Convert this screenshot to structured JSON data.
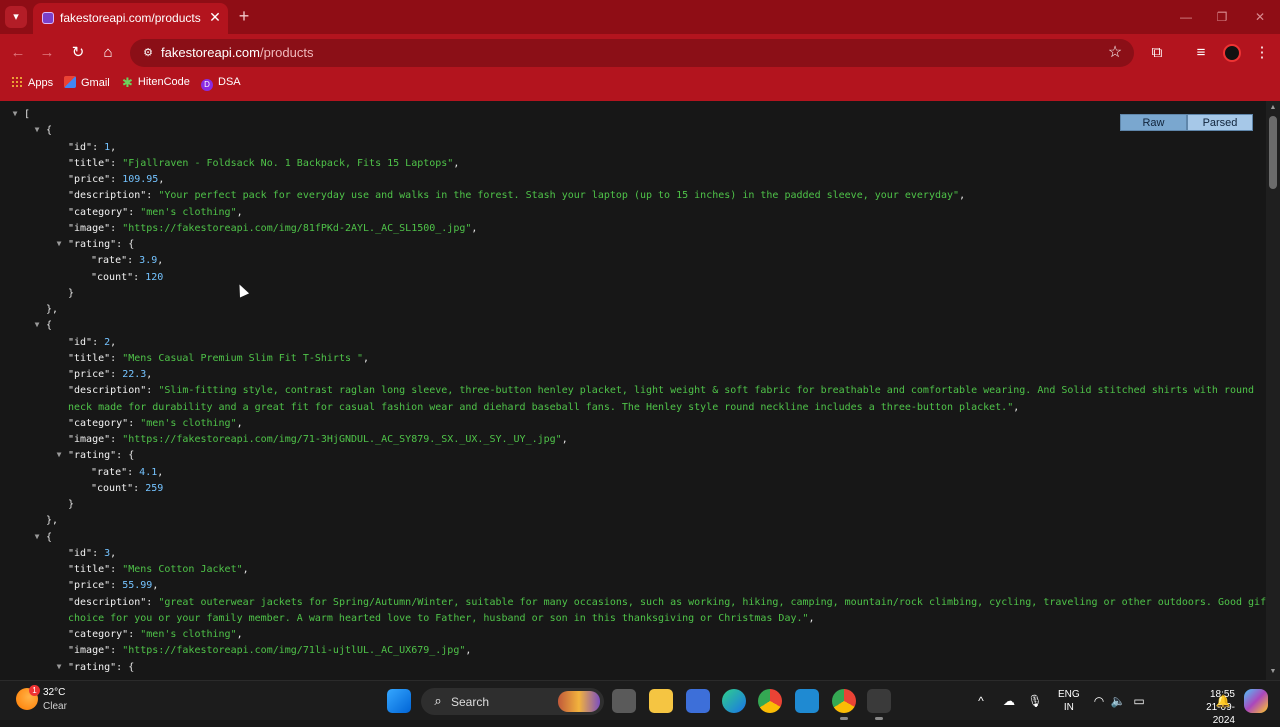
{
  "browser": {
    "tab_title": "fakestoreapi.com/products",
    "url_host": "fakestoreapi.com",
    "url_path": "/products",
    "bookmarks": [
      "Apps",
      "Gmail",
      "HitenCode",
      "DSA"
    ]
  },
  "viewer": {
    "raw_label": "Raw",
    "parsed_label": "Parsed"
  },
  "json_lines": [
    {
      "t": "[",
      "d": 0,
      "tog": true
    },
    {
      "t": "{",
      "d": 1,
      "tog": true
    },
    {
      "k": "id",
      "v": "1",
      "vt": "n",
      "d": 2
    },
    {
      "k": "title",
      "v": "\"Fjallraven - Foldsack No. 1 Backpack, Fits 15 Laptops\"",
      "vt": "s",
      "d": 2
    },
    {
      "k": "price",
      "v": "109.95",
      "vt": "n",
      "d": 2
    },
    {
      "k": "description",
      "v": "\"Your perfect pack for everyday use and walks in the forest. Stash your laptop (up to 15 inches) in the padded sleeve, your everyday\"",
      "vt": "s",
      "d": 2
    },
    {
      "k": "category",
      "v": "\"men's clothing\"",
      "vt": "s",
      "d": 2
    },
    {
      "k": "image",
      "v": "\"https://fakestoreapi.com/img/81fPKd-2AYL._AC_SL1500_.jpg\"",
      "vt": "s",
      "d": 2
    },
    {
      "k": "rating",
      "v": "{",
      "vt": "p",
      "d": 2,
      "tog": true,
      "nocomma": true
    },
    {
      "k": "rate",
      "v": "3.9",
      "vt": "n",
      "d": 3
    },
    {
      "k": "count",
      "v": "120",
      "vt": "n",
      "d": 3,
      "nocomma": true
    },
    {
      "t": "}",
      "d": 2
    },
    {
      "t": "},",
      "d": 1
    },
    {
      "t": "{",
      "d": 1,
      "tog": true
    },
    {
      "k": "id",
      "v": "2",
      "vt": "n",
      "d": 2
    },
    {
      "k": "title",
      "v": "\"Mens Casual Premium Slim Fit T-Shirts \"",
      "vt": "s",
      "d": 2
    },
    {
      "k": "price",
      "v": "22.3",
      "vt": "n",
      "d": 2
    },
    {
      "k": "description",
      "v": "\"Slim-fitting style, contrast raglan long sleeve, three-button henley placket, light weight & soft fabric for breathable and comfortable wearing. And Solid stitched shirts with round",
      "vt": "s",
      "d": 2,
      "nocomma": true
    },
    {
      "cont": "neck made for durability and a great fit for casual fashion wear and diehard baseball fans. The Henley style round neckline includes a three-button placket.\"",
      "vt": "s",
      "d": 2
    },
    {
      "k": "category",
      "v": "\"men's clothing\"",
      "vt": "s",
      "d": 2
    },
    {
      "k": "image",
      "v": "\"https://fakestoreapi.com/img/71-3HjGNDUL._AC_SY879._SX._UX._SY._UY_.jpg\"",
      "vt": "s",
      "d": 2
    },
    {
      "k": "rating",
      "v": "{",
      "vt": "p",
      "d": 2,
      "tog": true,
      "nocomma": true
    },
    {
      "k": "rate",
      "v": "4.1",
      "vt": "n",
      "d": 3
    },
    {
      "k": "count",
      "v": "259",
      "vt": "n",
      "d": 3,
      "nocomma": true
    },
    {
      "t": "}",
      "d": 2
    },
    {
      "t": "},",
      "d": 1
    },
    {
      "t": "{",
      "d": 1,
      "tog": true
    },
    {
      "k": "id",
      "v": "3",
      "vt": "n",
      "d": 2
    },
    {
      "k": "title",
      "v": "\"Mens Cotton Jacket\"",
      "vt": "s",
      "d": 2
    },
    {
      "k": "price",
      "v": "55.99",
      "vt": "n",
      "d": 2
    },
    {
      "k": "description",
      "v": "\"great outerwear jackets for Spring/Autumn/Winter, suitable for many occasions, such as working, hiking, camping, mountain/rock climbing, cycling, traveling or other outdoors. Good gift",
      "vt": "s",
      "d": 2,
      "nocomma": true
    },
    {
      "cont": "choice for you or your family member. A warm hearted love to Father, husband or son in this thanksgiving or Christmas Day.\"",
      "vt": "s",
      "d": 2
    },
    {
      "k": "category",
      "v": "\"men's clothing\"",
      "vt": "s",
      "d": 2
    },
    {
      "k": "image",
      "v": "\"https://fakestoreapi.com/img/71li-ujtlUL._AC_UX679_.jpg\"",
      "vt": "s",
      "d": 2
    },
    {
      "k": "rating",
      "v": "{",
      "vt": "p",
      "d": 2,
      "tog": true,
      "nocomma": true
    }
  ],
  "taskbar": {
    "weather_temp": "32°C",
    "weather_cond": "Clear",
    "weather_badge": "1",
    "search_label": "Search",
    "lang_line1": "ENG",
    "lang_line2": "IN",
    "time": "18:55",
    "date": "21-09-2024"
  },
  "colors": {
    "browser_frame": "#b3141e",
    "json_string": "#4fc349",
    "json_number": "#74c3ff"
  }
}
